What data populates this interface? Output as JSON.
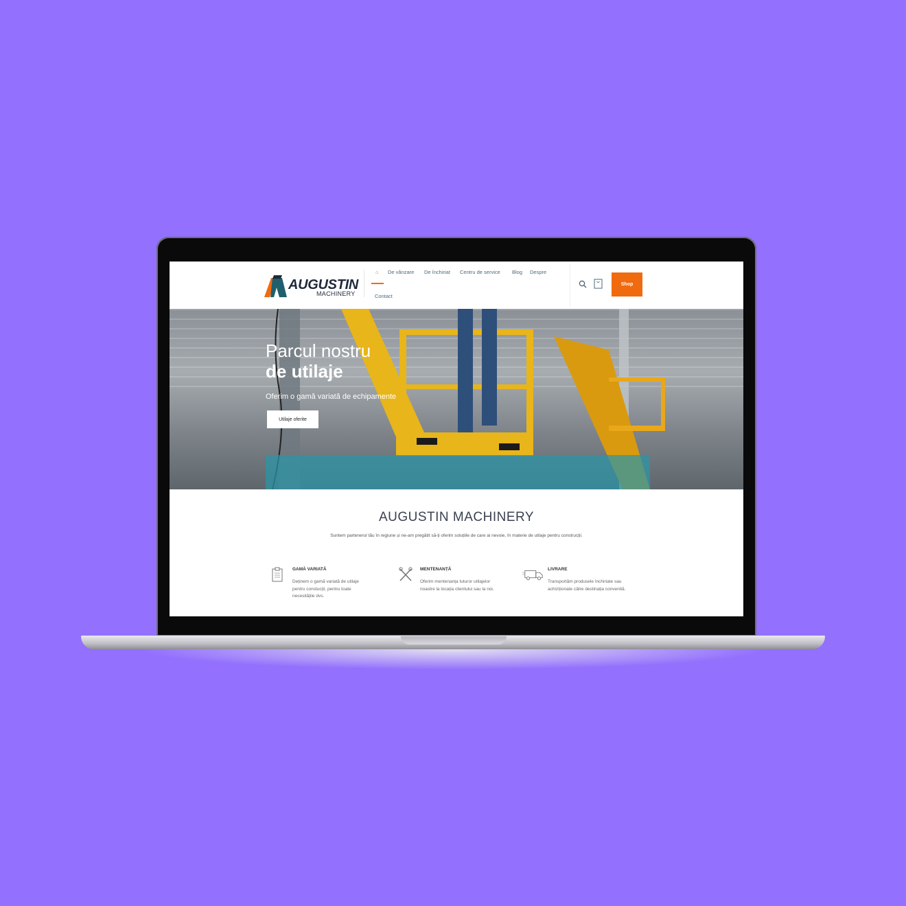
{
  "brand": {
    "name": "AUGUSTIN",
    "sub": "MACHINERY"
  },
  "nav": {
    "items": [
      "De vânzare",
      "De închiriat",
      "Centru de service",
      "Blog",
      "Despre",
      "Contact"
    ],
    "shop_label": "Shop"
  },
  "hero": {
    "title_line1": "Parcul nostru",
    "title_line2": "de utilaje",
    "subtitle": "Oferim o gamă variată de echipamente",
    "button_label": "Utilaje oferite"
  },
  "about": {
    "title": "AUGUSTIN MACHINERY",
    "description": "Suntem partenerul tău în regiune și ne-am pregătit să-ți oferim soluțiile de care ai nevoie, în materie de utilaje pentru construcții."
  },
  "features": [
    {
      "title": "GAMĂ VARIATĂ",
      "text": "Deținem o gamă variată de utilaje pentru constucții, pentru toate necesitățile dvs.",
      "icon": "clipboard-icon"
    },
    {
      "title": "MENTENANȚĂ",
      "text": "Oferim mentenanța tuturor utilajelor noastre la locația clientului sau la noi.",
      "icon": "tools-icon"
    },
    {
      "title": "LIVRARE",
      "text": "Transportăm produsele închiriate sau achiziționate către destinația convenită.",
      "icon": "truck-icon"
    }
  ],
  "colors": {
    "accent": "#f06a0f",
    "background": "#9370fd",
    "teal": "#2a96a8"
  }
}
